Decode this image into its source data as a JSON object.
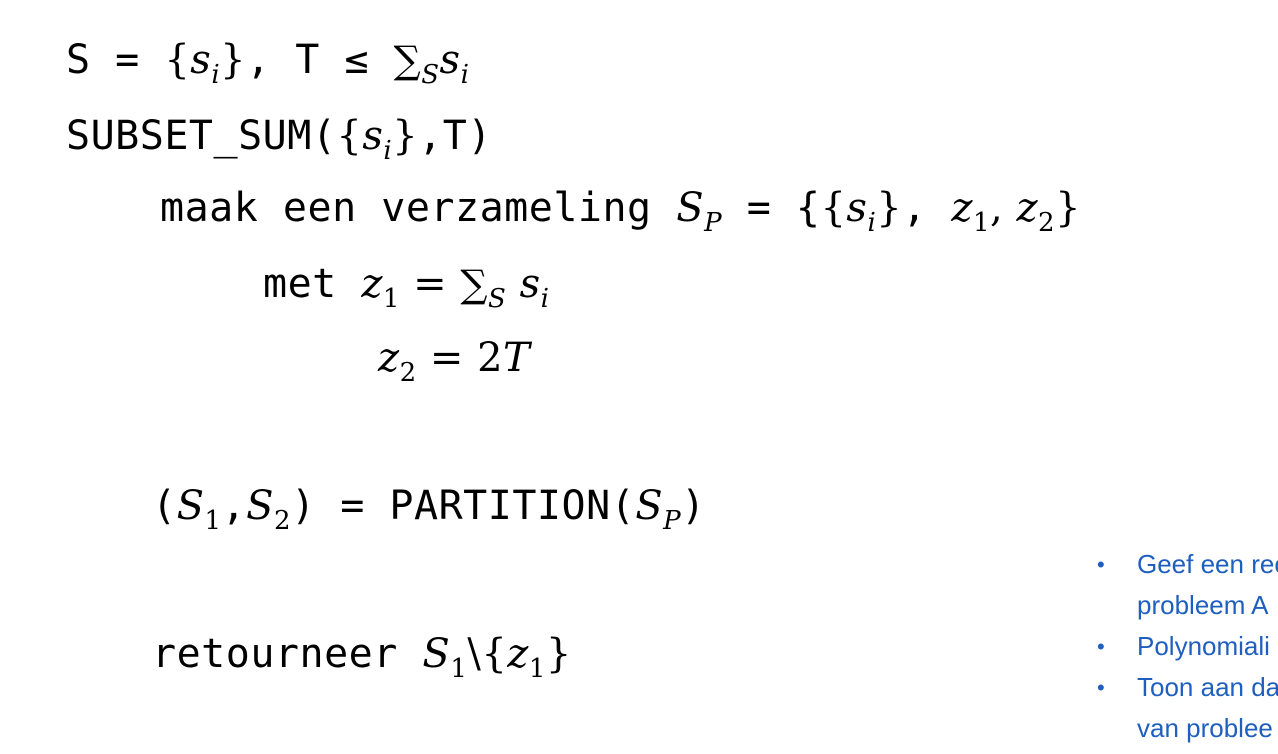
{
  "lines": {
    "l1": {
      "code_a": "S = ",
      "brace_open": "{",
      "s": "s",
      "sub_i": "i",
      "brace_close": "}",
      "code_b": ", T ≤ ",
      "sigma": "∑",
      "sub_s": "S",
      "s2": "s",
      "sub_i2": "i"
    },
    "l2": {
      "code_a": "SUBSET_SUM(",
      "brace_open": "{",
      "s": "s",
      "sub_i": "i",
      "brace_close": "}",
      "code_b": ",T)"
    },
    "l3": {
      "code_a": "maak een verzameling ",
      "S": "S",
      "sub_p": "P",
      "code_b": " = {",
      "brace_open": "{",
      "s": "s",
      "sub_i": "i",
      "brace_close": "}",
      "code_c": ", ",
      "z1": "z",
      "sub_1": "1",
      "comma": ", ",
      "z2": "z",
      "sub_2": "2",
      "brace_end": "}"
    },
    "l4": {
      "code_a": "met ",
      "z": "z",
      "sub_1": "1",
      "eq": " = ",
      "sigma": "∑",
      "sub_s": "S",
      "s": " s",
      "sub_i": "i"
    },
    "l5": {
      "z": "z",
      "sub_2": "2",
      "eq": " = 2",
      "T": "T"
    },
    "l6": {
      "paren_open": "(",
      "S1": "S",
      "sub_1": "1",
      "comma": ",",
      "S2": "S",
      "sub_2": "2",
      "code_a": ") = PARTITION(",
      "Sp": "S",
      "sub_p": "P",
      "paren_close": ")"
    },
    "l7": {
      "code_a": "retourneer ",
      "S": "S",
      "sub_1": "1",
      "setminus": "\\{",
      "z": "z",
      "sub_z1": "1",
      "brace_close": "}"
    }
  },
  "notes": [
    {
      "bullet": "•",
      "text": "Geef een rec",
      "cont": "probleem A"
    },
    {
      "bullet": "•",
      "text": "Polynomiali",
      "cont": ""
    },
    {
      "bullet": "•",
      "text": "Toon aan da",
      "cont": "van problee"
    }
  ],
  "colors": {
    "text": "#000000",
    "notes": "#1f5fbf",
    "background": "#ffffff"
  }
}
